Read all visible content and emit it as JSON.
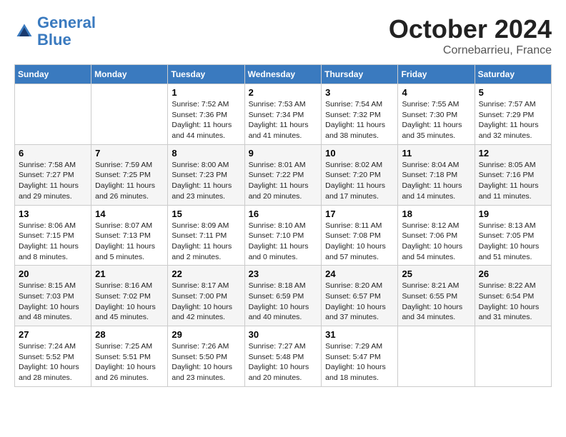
{
  "logo": {
    "line1": "General",
    "line2": "Blue"
  },
  "header": {
    "month": "October 2024",
    "location": "Cornebarrieu, France"
  },
  "weekdays": [
    "Sunday",
    "Monday",
    "Tuesday",
    "Wednesday",
    "Thursday",
    "Friday",
    "Saturday"
  ],
  "weeks": [
    [
      {
        "day": null
      },
      {
        "day": null
      },
      {
        "day": "1",
        "sunrise": "Sunrise: 7:52 AM",
        "sunset": "Sunset: 7:36 PM",
        "daylight": "Daylight: 11 hours and 44 minutes."
      },
      {
        "day": "2",
        "sunrise": "Sunrise: 7:53 AM",
        "sunset": "Sunset: 7:34 PM",
        "daylight": "Daylight: 11 hours and 41 minutes."
      },
      {
        "day": "3",
        "sunrise": "Sunrise: 7:54 AM",
        "sunset": "Sunset: 7:32 PM",
        "daylight": "Daylight: 11 hours and 38 minutes."
      },
      {
        "day": "4",
        "sunrise": "Sunrise: 7:55 AM",
        "sunset": "Sunset: 7:30 PM",
        "daylight": "Daylight: 11 hours and 35 minutes."
      },
      {
        "day": "5",
        "sunrise": "Sunrise: 7:57 AM",
        "sunset": "Sunset: 7:29 PM",
        "daylight": "Daylight: 11 hours and 32 minutes."
      }
    ],
    [
      {
        "day": "6",
        "sunrise": "Sunrise: 7:58 AM",
        "sunset": "Sunset: 7:27 PM",
        "daylight": "Daylight: 11 hours and 29 minutes."
      },
      {
        "day": "7",
        "sunrise": "Sunrise: 7:59 AM",
        "sunset": "Sunset: 7:25 PM",
        "daylight": "Daylight: 11 hours and 26 minutes."
      },
      {
        "day": "8",
        "sunrise": "Sunrise: 8:00 AM",
        "sunset": "Sunset: 7:23 PM",
        "daylight": "Daylight: 11 hours and 23 minutes."
      },
      {
        "day": "9",
        "sunrise": "Sunrise: 8:01 AM",
        "sunset": "Sunset: 7:22 PM",
        "daylight": "Daylight: 11 hours and 20 minutes."
      },
      {
        "day": "10",
        "sunrise": "Sunrise: 8:02 AM",
        "sunset": "Sunset: 7:20 PM",
        "daylight": "Daylight: 11 hours and 17 minutes."
      },
      {
        "day": "11",
        "sunrise": "Sunrise: 8:04 AM",
        "sunset": "Sunset: 7:18 PM",
        "daylight": "Daylight: 11 hours and 14 minutes."
      },
      {
        "day": "12",
        "sunrise": "Sunrise: 8:05 AM",
        "sunset": "Sunset: 7:16 PM",
        "daylight": "Daylight: 11 hours and 11 minutes."
      }
    ],
    [
      {
        "day": "13",
        "sunrise": "Sunrise: 8:06 AM",
        "sunset": "Sunset: 7:15 PM",
        "daylight": "Daylight: 11 hours and 8 minutes."
      },
      {
        "day": "14",
        "sunrise": "Sunrise: 8:07 AM",
        "sunset": "Sunset: 7:13 PM",
        "daylight": "Daylight: 11 hours and 5 minutes."
      },
      {
        "day": "15",
        "sunrise": "Sunrise: 8:09 AM",
        "sunset": "Sunset: 7:11 PM",
        "daylight": "Daylight: 11 hours and 2 minutes."
      },
      {
        "day": "16",
        "sunrise": "Sunrise: 8:10 AM",
        "sunset": "Sunset: 7:10 PM",
        "daylight": "Daylight: 11 hours and 0 minutes."
      },
      {
        "day": "17",
        "sunrise": "Sunrise: 8:11 AM",
        "sunset": "Sunset: 7:08 PM",
        "daylight": "Daylight: 10 hours and 57 minutes."
      },
      {
        "day": "18",
        "sunrise": "Sunrise: 8:12 AM",
        "sunset": "Sunset: 7:06 PM",
        "daylight": "Daylight: 10 hours and 54 minutes."
      },
      {
        "day": "19",
        "sunrise": "Sunrise: 8:13 AM",
        "sunset": "Sunset: 7:05 PM",
        "daylight": "Daylight: 10 hours and 51 minutes."
      }
    ],
    [
      {
        "day": "20",
        "sunrise": "Sunrise: 8:15 AM",
        "sunset": "Sunset: 7:03 PM",
        "daylight": "Daylight: 10 hours and 48 minutes."
      },
      {
        "day": "21",
        "sunrise": "Sunrise: 8:16 AM",
        "sunset": "Sunset: 7:02 PM",
        "daylight": "Daylight: 10 hours and 45 minutes."
      },
      {
        "day": "22",
        "sunrise": "Sunrise: 8:17 AM",
        "sunset": "Sunset: 7:00 PM",
        "daylight": "Daylight: 10 hours and 42 minutes."
      },
      {
        "day": "23",
        "sunrise": "Sunrise: 8:18 AM",
        "sunset": "Sunset: 6:59 PM",
        "daylight": "Daylight: 10 hours and 40 minutes."
      },
      {
        "day": "24",
        "sunrise": "Sunrise: 8:20 AM",
        "sunset": "Sunset: 6:57 PM",
        "daylight": "Daylight: 10 hours and 37 minutes."
      },
      {
        "day": "25",
        "sunrise": "Sunrise: 8:21 AM",
        "sunset": "Sunset: 6:55 PM",
        "daylight": "Daylight: 10 hours and 34 minutes."
      },
      {
        "day": "26",
        "sunrise": "Sunrise: 8:22 AM",
        "sunset": "Sunset: 6:54 PM",
        "daylight": "Daylight: 10 hours and 31 minutes."
      }
    ],
    [
      {
        "day": "27",
        "sunrise": "Sunrise: 7:24 AM",
        "sunset": "Sunset: 5:52 PM",
        "daylight": "Daylight: 10 hours and 28 minutes."
      },
      {
        "day": "28",
        "sunrise": "Sunrise: 7:25 AM",
        "sunset": "Sunset: 5:51 PM",
        "daylight": "Daylight: 10 hours and 26 minutes."
      },
      {
        "day": "29",
        "sunrise": "Sunrise: 7:26 AM",
        "sunset": "Sunset: 5:50 PM",
        "daylight": "Daylight: 10 hours and 23 minutes."
      },
      {
        "day": "30",
        "sunrise": "Sunrise: 7:27 AM",
        "sunset": "Sunset: 5:48 PM",
        "daylight": "Daylight: 10 hours and 20 minutes."
      },
      {
        "day": "31",
        "sunrise": "Sunrise: 7:29 AM",
        "sunset": "Sunset: 5:47 PM",
        "daylight": "Daylight: 10 hours and 18 minutes."
      },
      {
        "day": null
      },
      {
        "day": null
      }
    ]
  ]
}
